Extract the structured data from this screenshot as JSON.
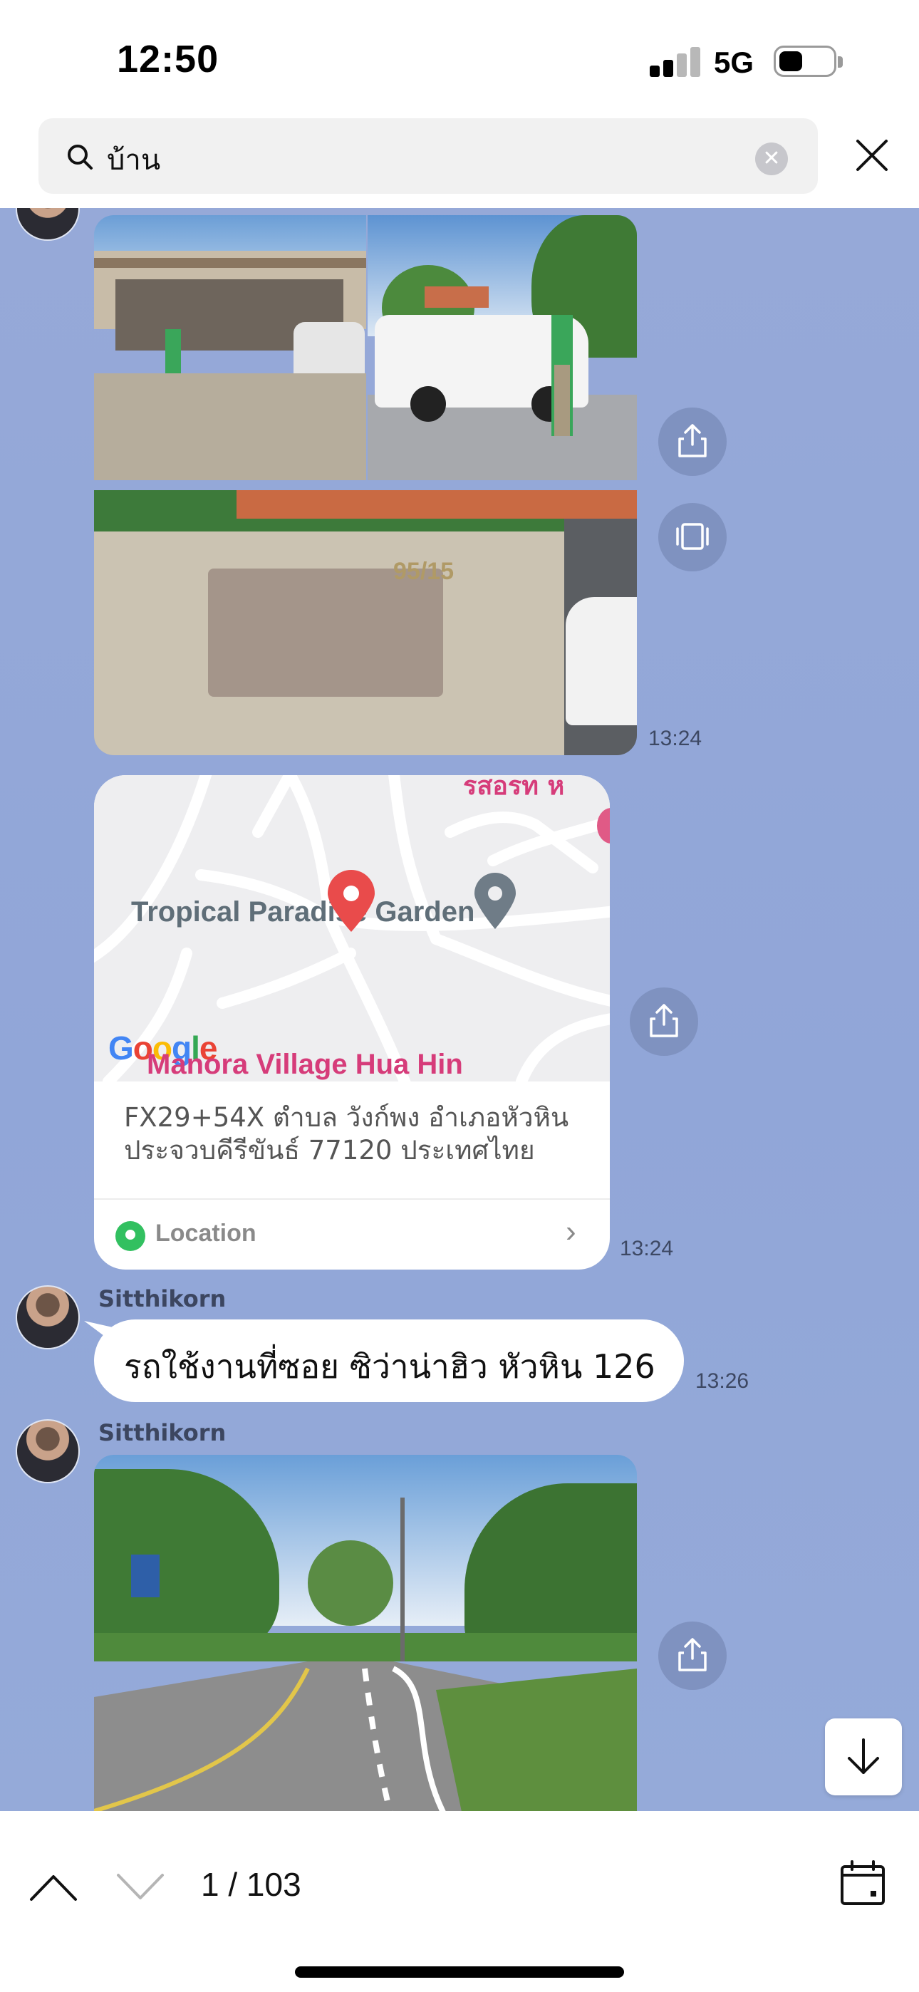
{
  "status_bar": {
    "time": "12:50",
    "network": "5G",
    "battery_level": 0.45
  },
  "search": {
    "query": "บ้าน",
    "clear_icon": "clear-icon",
    "close_icon": "close-icon"
  },
  "messages": {
    "photo_group": {
      "timestamp": "13:24",
      "photo_3_plate": "95/15"
    },
    "location": {
      "map_title": "Tropical Paradise Garden",
      "map_bottom_label": "Manora Village Hua Hin",
      "map_top_label": "รสอรท ห",
      "google_logo": "Google",
      "address": "FX29+54X ตำบล วังก์พง อำเภอหัวหิน ประจวบคีรีขันธ์ 77120 ประเทศไทย",
      "location_label": "Location",
      "timestamp": "13:24"
    },
    "text_message": {
      "sender": "Sitthikorn",
      "text": "รถใช้งานที่ซอย  ซิว่าน่าฮิว หัวหิน 126",
      "timestamp": "13:26"
    },
    "photo_message": {
      "sender": "Sitthikorn"
    }
  },
  "bottom_bar": {
    "counter": "1 / 103"
  },
  "colors": {
    "chat_background": "#93a8d8",
    "map_pin": "#e94b4b",
    "location_green": "#32c060",
    "map_label_pink": "#d63c7a"
  }
}
